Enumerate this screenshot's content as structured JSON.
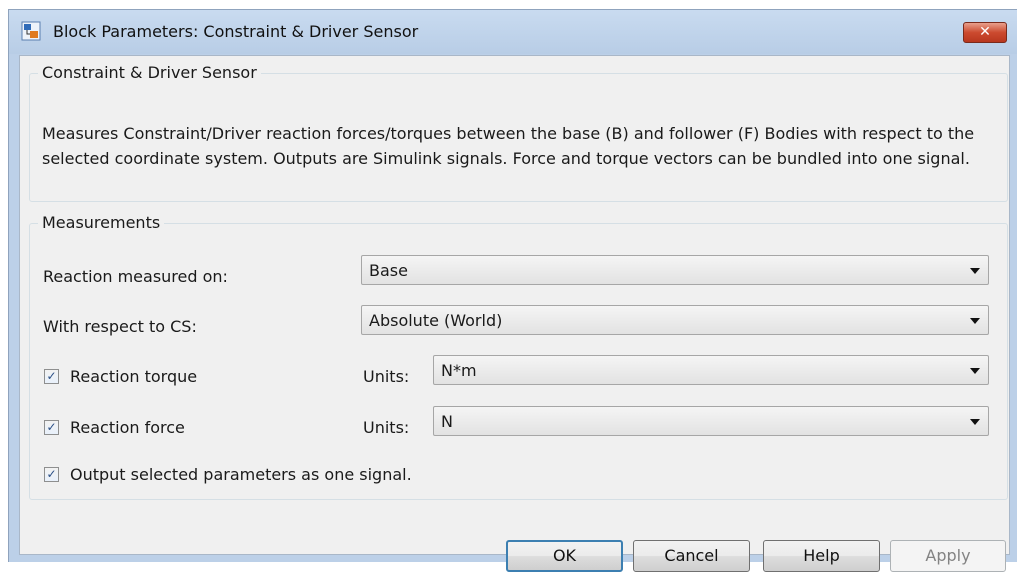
{
  "window": {
    "title": "Block Parameters: Constraint & Driver Sensor",
    "close_glyph": "✕"
  },
  "description_group": {
    "legend": "Constraint & Driver Sensor",
    "text": "Measures Constraint/Driver reaction forces/torques between the base (B) and follower (F) Bodies with respect to the selected coordinate system. Outputs are Simulink signals. Force and torque vectors can be bundled into one signal."
  },
  "measurements": {
    "legend": "Measurements",
    "reaction_measured_on": {
      "label": "Reaction measured on:",
      "value": "Base"
    },
    "with_respect_to_cs": {
      "label": "With respect to CS:",
      "value": "Absolute (World)"
    },
    "reaction_torque": {
      "label": "Reaction torque",
      "checked": true,
      "units_label": "Units:",
      "units_value": "N*m"
    },
    "reaction_force": {
      "label": "Reaction force",
      "checked": true,
      "units_label": "Units:",
      "units_value": "N"
    },
    "output_one_signal": {
      "label": "Output selected parameters as one signal.",
      "checked": true
    }
  },
  "buttons": {
    "ok": "OK",
    "cancel": "Cancel",
    "help": "Help",
    "apply": "Apply"
  },
  "check_glyph": "✓",
  "colors": {
    "titlebar": "#c9dbf0",
    "close": "#cc4a2f",
    "default_button_border": "#3c7fb1"
  }
}
